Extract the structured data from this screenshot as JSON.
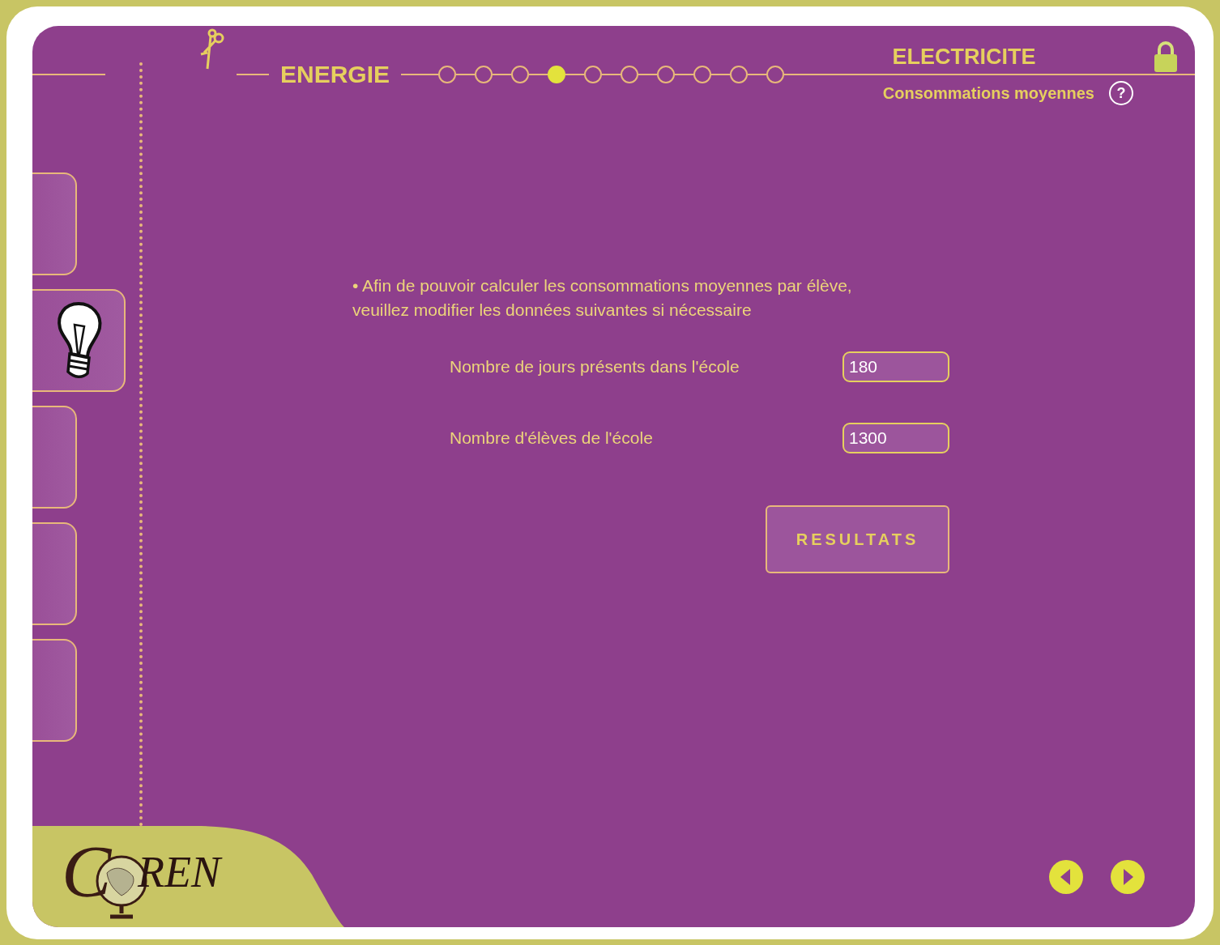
{
  "header": {
    "section": "ENERGIE",
    "steps": [
      {
        "selected": false
      },
      {
        "selected": false
      },
      {
        "selected": false
      },
      {
        "selected": true
      },
      {
        "selected": false
      },
      {
        "selected": false
      },
      {
        "selected": false
      },
      {
        "selected": false
      },
      {
        "selected": false
      },
      {
        "selected": false
      }
    ],
    "title": "ELECTRICITE",
    "subtitle": "Consommations moyennes",
    "help": "?"
  },
  "sidebar": {
    "tabs": [
      {
        "selected": false,
        "kind": "empty"
      },
      {
        "selected": true,
        "kind": "bulb"
      },
      {
        "selected": false,
        "kind": "empty"
      },
      {
        "selected": false,
        "kind": "empty"
      },
      {
        "selected": false,
        "kind": "empty"
      }
    ]
  },
  "instructions": [
    "• Afin de pouvoir calculer les consommations moyennes par élève,",
    "veuillez modifier les données suivantes si nécessaire"
  ],
  "fields": [
    {
      "label": "Nombre de jours présents dans l'école",
      "value": "180"
    },
    {
      "label": "Nombre d'élèves de l'école",
      "value": "1300"
    }
  ],
  "submit_button": "RESULTATS",
  "logo": {
    "initial": "C",
    "name": "REN"
  }
}
